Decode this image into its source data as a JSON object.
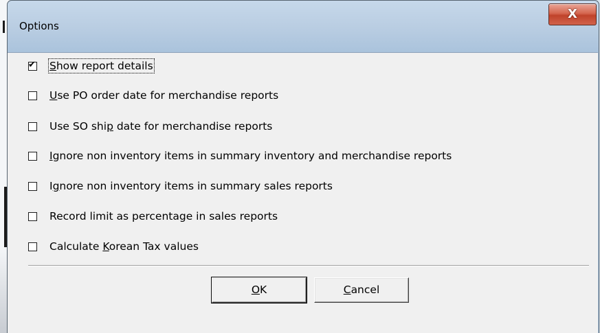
{
  "window": {
    "title": "Options",
    "close_symbol": "X"
  },
  "options": [
    {
      "label_pre": "",
      "label_key": "S",
      "label_post": "how report details",
      "checked": true
    },
    {
      "label_pre": "",
      "label_key": "U",
      "label_post": "se PO order date for merchandise reports",
      "checked": false
    },
    {
      "label_pre": "Use SO shi",
      "label_key": "p",
      "label_post": " date for merchandise reports",
      "checked": false
    },
    {
      "label_pre": "",
      "label_key": "I",
      "label_post": "gnore non inventory items in summary inventory and merchandise reports",
      "checked": false
    },
    {
      "label_pre": "I",
      "label_key": "g",
      "label_post": "nore non inventory items in summary sales reports",
      "checked": false
    },
    {
      "label_pre": "Record limit as percentage in sales reports",
      "label_key": "",
      "label_post": "",
      "checked": false
    },
    {
      "label_pre": "Calculate ",
      "label_key": "K",
      "label_post": "orean Tax values",
      "checked": false
    }
  ],
  "buttons": {
    "ok": {
      "key": "O",
      "rest": "K"
    },
    "cancel": {
      "key": "C",
      "rest": "ancel"
    }
  },
  "check_glyph": "✔"
}
